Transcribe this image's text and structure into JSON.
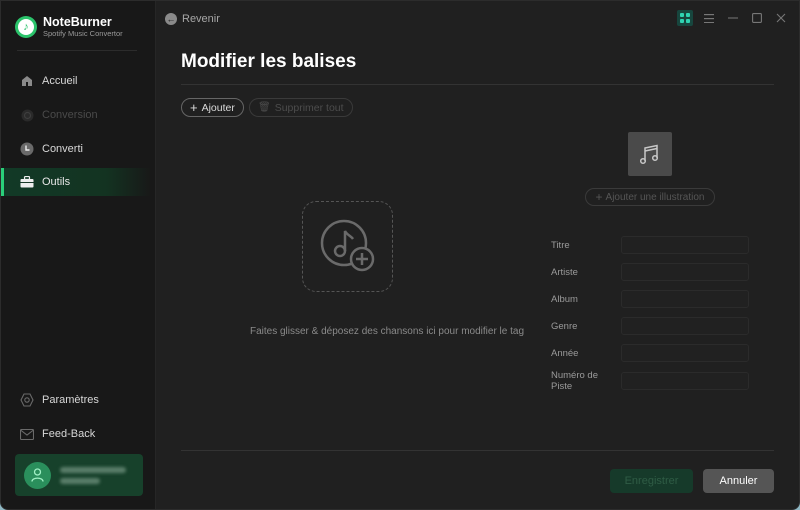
{
  "app": {
    "name": "NoteBurner",
    "subtitle": "Spotify Music Convertor"
  },
  "sidebar": {
    "items": [
      {
        "label": "Accueil",
        "icon": "home-icon",
        "state": "normal"
      },
      {
        "label": "Conversion",
        "icon": "sync-icon",
        "state": "disabled"
      },
      {
        "label": "Converti",
        "icon": "clock-icon",
        "state": "normal"
      },
      {
        "label": "Outils",
        "icon": "toolbox-icon",
        "state": "active"
      }
    ],
    "bottom_items": [
      {
        "label": "Paramètres",
        "icon": "gear-icon"
      },
      {
        "label": "Feed-Back",
        "icon": "mail-icon"
      }
    ],
    "user": {
      "icon": "user-icon",
      "blurred": true
    }
  },
  "topbar": {
    "back_label": "Revenir",
    "controls": [
      "grid-icon",
      "menu-icon",
      "minimize-icon",
      "maximize-icon",
      "close-icon"
    ]
  },
  "main": {
    "title": "Modifier les balises",
    "add_label": "Ajouter",
    "delete_all_label": "Supprimer tout",
    "drop_text": "Faites glisser & déposez des chansons ici pour modifier le tag",
    "add_artwork_label": "Ajouter une illustration",
    "fields": [
      {
        "label": "Titre",
        "value": ""
      },
      {
        "label": "Artiste",
        "value": ""
      },
      {
        "label": "Album",
        "value": ""
      },
      {
        "label": "Genre",
        "value": ""
      },
      {
        "label": "Année",
        "value": ""
      },
      {
        "label": "Numéro de Piste",
        "value": ""
      }
    ],
    "save_label": "Enregistrer",
    "cancel_label": "Annuler"
  },
  "colors": {
    "accent": "#2ad07a",
    "active_bg": "#123a27",
    "background": "#202020",
    "sidebar_bg": "#181818"
  }
}
